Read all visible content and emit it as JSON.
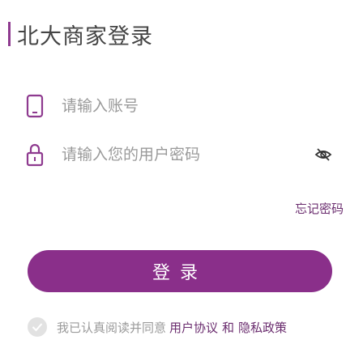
{
  "header": {
    "title": "北大商家登录"
  },
  "account_field": {
    "icon": "phone-icon",
    "placeholder": "请输入账号"
  },
  "password_field": {
    "icon": "lock-icon",
    "placeholder": "请输入您的用户密码",
    "toggle_icon": "eye-off-icon"
  },
  "forgot_password": "忘记密码",
  "login_button": "登录",
  "agreement": {
    "prefix": "我已认真阅读并同意",
    "user_agreement": "用户协议",
    "conjunction": "和",
    "privacy_policy": "隐私政策"
  },
  "colors": {
    "accent": "#8e3a8f",
    "button": "#8a2f8a",
    "link": "#6a2c6e"
  }
}
